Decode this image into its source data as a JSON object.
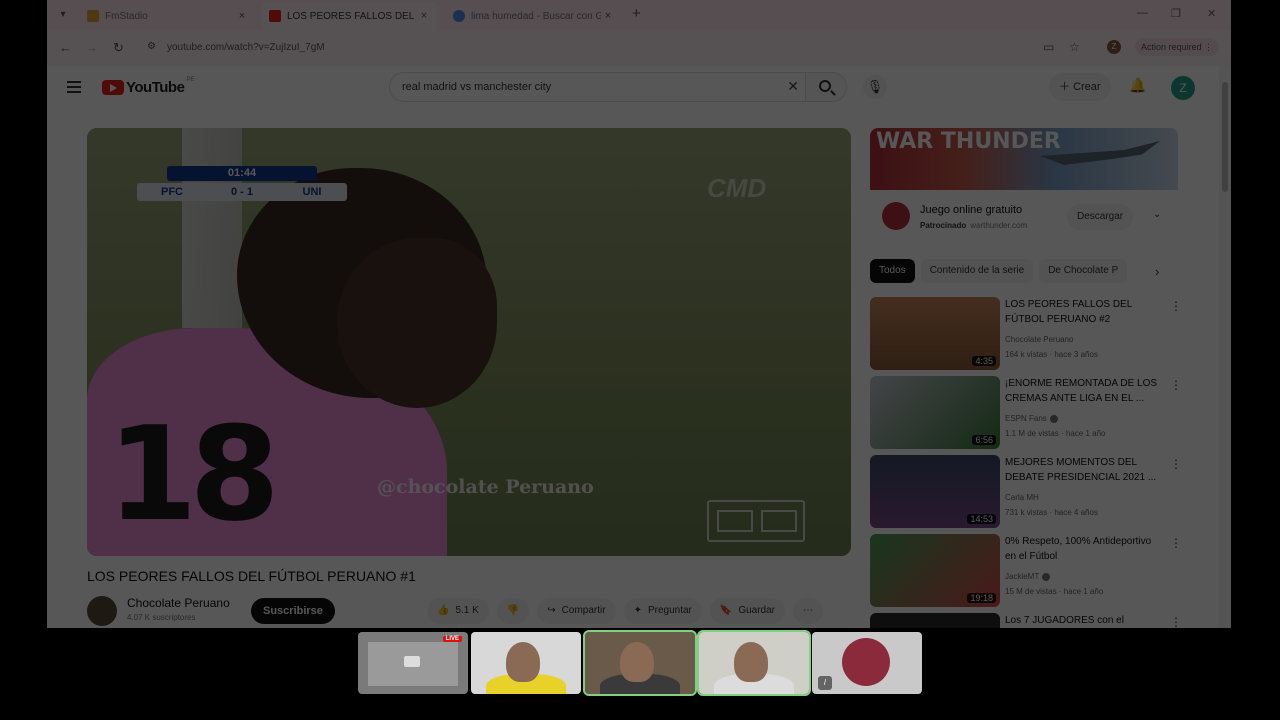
{
  "browser": {
    "tabs": [
      {
        "title": "FmStadio",
        "active": false
      },
      {
        "title": "LOS PEORES FALLOS DEL FÚTB",
        "active": true
      },
      {
        "title": "lima humedad - Buscar con Go",
        "active": false
      }
    ],
    "url": "youtube.com/watch?v=ZujIzuI_7gM",
    "action_required": "Action required",
    "profile_initial": "Z"
  },
  "youtube": {
    "logo_text": "YouTube",
    "country_code": "PE",
    "search_query": "real madrid vs manchester city",
    "create_label": "Crear",
    "avatar_initial": "Z",
    "player": {
      "score_clock": "01:44",
      "home_team": "PFC",
      "score": "0 - 1",
      "away_team": "UNI",
      "broadcaster_watermark": "CMD",
      "handle_watermark": "@chocolate Peruano",
      "jersey_number": "18"
    },
    "video": {
      "title": "LOS PEORES FALLOS DEL FÚTBOL PERUANO #1",
      "channel": "Chocolate Peruano",
      "subscribers": "4.07 K suscriptores",
      "subscribe_label": "Suscribirse",
      "likes": "5.1 K",
      "share_label": "Compartir",
      "ask_label": "Preguntar",
      "save_label": "Guardar"
    },
    "ad": {
      "banner_text": "WAR THUNDER",
      "title": "Juego online gratuito",
      "sponsored": "Patrocinado",
      "domain": "warthunder.com",
      "cta": "Descargar"
    },
    "chips": [
      "Todos",
      "Contenido de la serie",
      "De Chocolate P"
    ],
    "recommendations": [
      {
        "title": "LOS PEORES FALLOS DEL FÚTBOL PERUANO #2",
        "channel": "Chocolate Peruano",
        "meta": "164 k vistas · hace 3 años",
        "duration": "4:35",
        "verified": false
      },
      {
        "title": "¡ENORME REMONTADA DE LOS CREMAS ANTE LIGA EN EL ...",
        "channel": "ESPN Fans",
        "meta": "1.1 M de vistas · hace 1 año",
        "duration": "6:56",
        "verified": true
      },
      {
        "title": "MEJORES MOMENTOS DEL DEBATE PRESIDENCIAL 2021 ...",
        "channel": "Carla MH",
        "meta": "731 k vistas · hace 4 años",
        "duration": "14:53",
        "verified": false
      },
      {
        "title": "0% Respeto, 100% Antideportivo en el Fútbol",
        "channel": "JackieMT",
        "meta": "15 M de vistas · hace 1 año",
        "duration": "19:18",
        "verified": true
      },
      {
        "title": "Los 7 JUGADORES con el",
        "channel": "",
        "meta": "",
        "duration": "",
        "verified": false
      }
    ]
  },
  "call": {
    "live_badge": "LIVE"
  },
  "colors": {
    "yt_red": "#e62117",
    "avatar": "#25a18e",
    "tab_strip": "#fbe3ec",
    "speaking_outline": "#7fd07f"
  }
}
